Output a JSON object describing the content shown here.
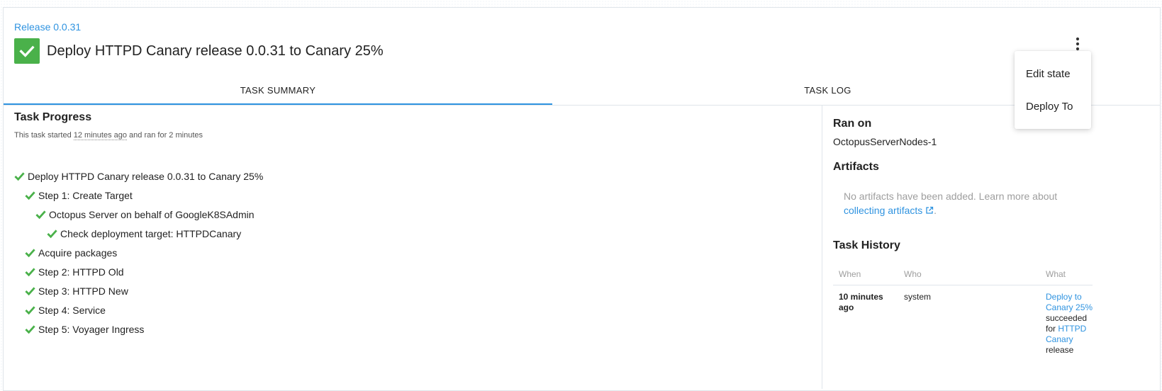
{
  "header": {
    "release_link": "Release 0.0.31",
    "title": "Deploy HTTPD Canary release 0.0.31 to Canary 25%",
    "status": "success"
  },
  "tabs": [
    {
      "label": "TASK SUMMARY",
      "active": true
    },
    {
      "label": "TASK LOG",
      "active": false
    }
  ],
  "task_progress": {
    "title": "Task Progress",
    "started_prefix": "This task started ",
    "started_ago": "12 minutes ago",
    "started_suffix": " and ran for 2 minutes",
    "items": [
      {
        "label": "Deploy HTTPD Canary release 0.0.31 to Canary 25%",
        "depth": 0,
        "status": "success"
      },
      {
        "label": "Step 1: Create Target",
        "depth": 1,
        "status": "success"
      },
      {
        "label": "Octopus Server on behalf of GoogleK8SAdmin",
        "depth": 2,
        "status": "success"
      },
      {
        "label": "Check deployment target: HTTPDCanary",
        "depth": 3,
        "status": "success"
      },
      {
        "label": "Acquire packages",
        "depth": 1,
        "status": "success"
      },
      {
        "label": "Step 2: HTTPD Old",
        "depth": 1,
        "status": "success"
      },
      {
        "label": "Step 3: HTTPD New",
        "depth": 1,
        "status": "success"
      },
      {
        "label": "Step 4: Service",
        "depth": 1,
        "status": "success"
      },
      {
        "label": "Step 5: Voyager Ingress",
        "depth": 1,
        "status": "success"
      }
    ]
  },
  "ran_on": {
    "title": "Ran on",
    "value": "OctopusServerNodes-1"
  },
  "artifacts": {
    "title": "Artifacts",
    "note": "No artifacts have been added. Learn more about ",
    "link": "collecting artifacts",
    "after_link": "."
  },
  "task_history": {
    "title": "Task History",
    "columns": {
      "when": "When",
      "who": "Who",
      "what": "What"
    },
    "rows": [
      {
        "when": "10 minutes ago",
        "who": "system",
        "what_link1": "Deploy to Canary 25%",
        "what_mid": " succeeded for ",
        "what_link2": "HTTPD Canary",
        "what_tail": " release"
      }
    ]
  },
  "overflow_menu": {
    "items": [
      {
        "label": "Edit state"
      },
      {
        "label": "Deploy To"
      }
    ]
  },
  "colors": {
    "accent": "#2f93e0",
    "success": "#4ab14a"
  }
}
